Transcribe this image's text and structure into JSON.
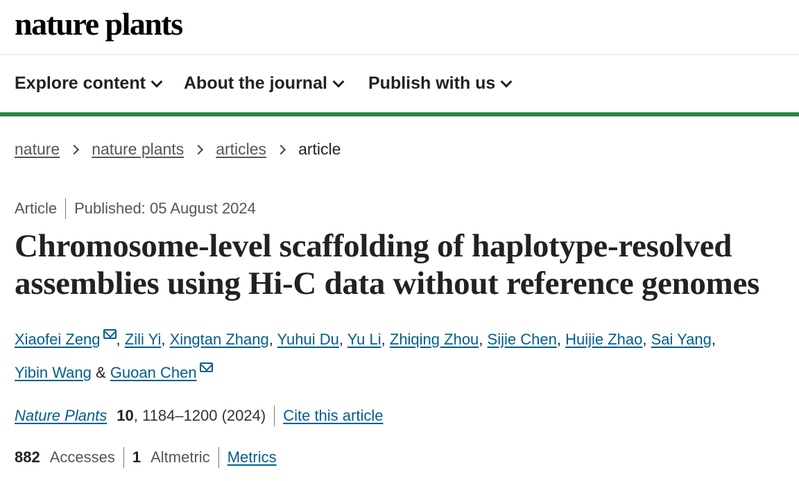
{
  "header": {
    "logo": "nature plants"
  },
  "nav": {
    "items": [
      {
        "label": "Explore content"
      },
      {
        "label": "About the journal"
      },
      {
        "label": "Publish with us"
      }
    ]
  },
  "breadcrumb": {
    "items": [
      "nature",
      "nature plants",
      "articles"
    ],
    "current": "article"
  },
  "meta": {
    "type": "Article",
    "published": "Published: 05 August 2024"
  },
  "article": {
    "title": "Chromosome-level scaffolding of haplotype-resolved assemblies using Hi-C data without reference genomes"
  },
  "authors": {
    "list": [
      "Xiaofei Zeng",
      "Zili Yi",
      "Xingtan Zhang",
      "Yuhui Du",
      "Yu Li",
      "Zhiqing Zhou",
      "Sijie Chen",
      "Huijie Zhao",
      "Sai Yang",
      "Yibin Wang",
      "Guoan Chen"
    ],
    "separator": ",",
    "conjunction": "&"
  },
  "citation": {
    "journal": "Nature Plants",
    "volume": "10",
    "pages": ", 1184–1200 (2024)",
    "cite_label": "Cite this article"
  },
  "stats": {
    "accesses_count": "882",
    "accesses_label": "Accesses",
    "altmetric_count": "1",
    "altmetric_label": "Altmetric",
    "metrics_label": "Metrics"
  },
  "colors": {
    "accent_bar": "#2e8540",
    "link": "#025e8d"
  }
}
